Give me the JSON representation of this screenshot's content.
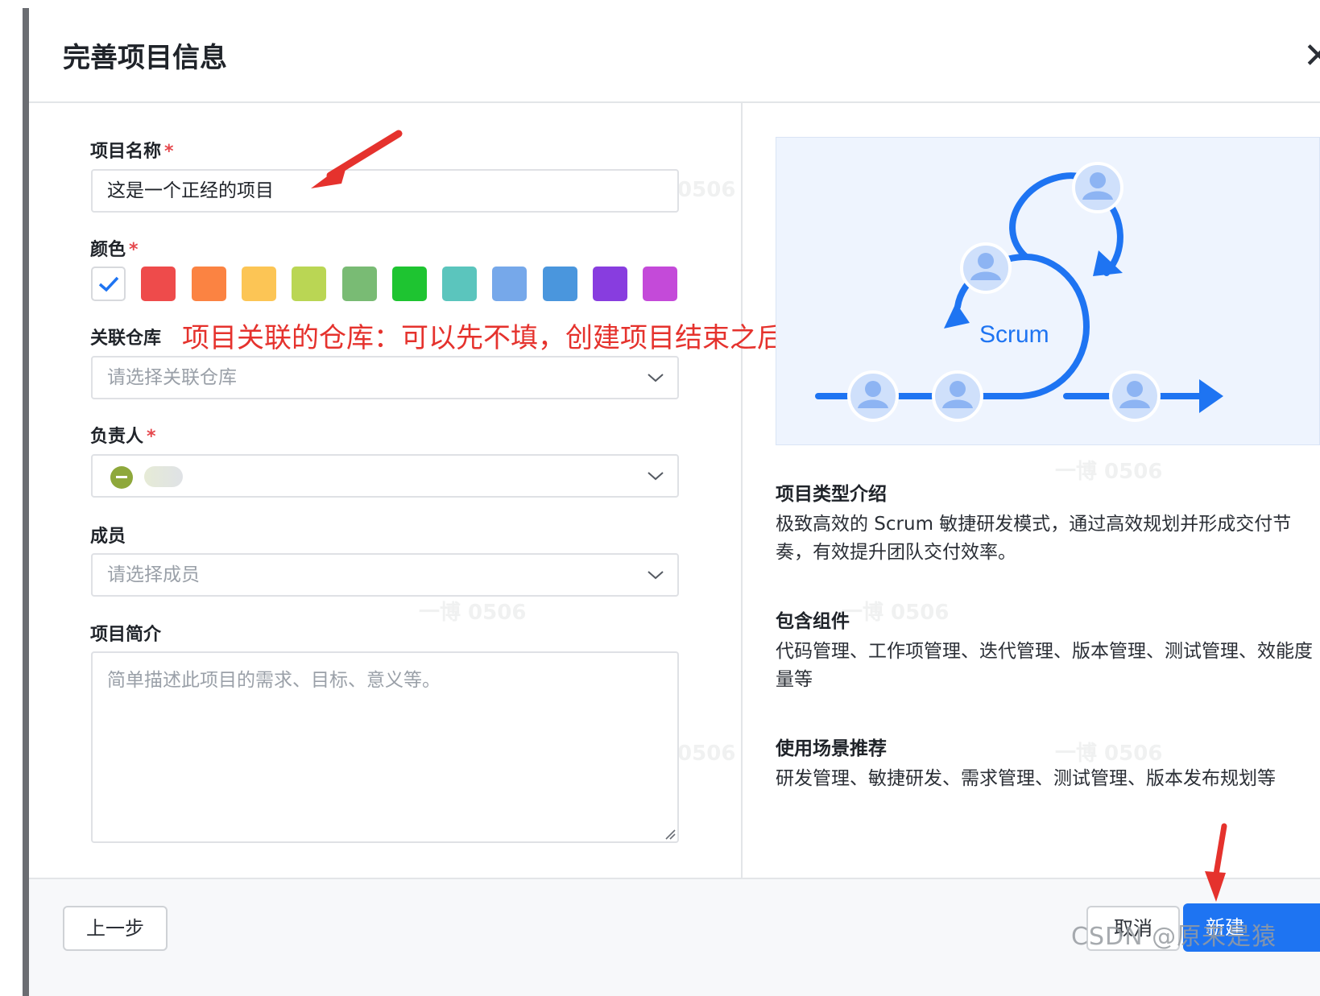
{
  "dialog": {
    "title": "完善项目信息"
  },
  "form": {
    "project_name": {
      "label": "项目名称",
      "required_mark": "*",
      "value": "这是一个正经的项目"
    },
    "color": {
      "label": "颜色",
      "required_mark": "*",
      "swatches": [
        "#ffffff",
        "#ee4b4b",
        "#fb8342",
        "#fcc555",
        "#bad654",
        "#79bb74",
        "#1ec431",
        "#5bc5bd",
        "#76a8ea",
        "#4a96dd",
        "#883ddf",
        "#c44ad9"
      ],
      "selected_index": 0
    },
    "repository": {
      "label": "关联仓库",
      "placeholder": "请选择关联仓库"
    },
    "owner": {
      "label": "负责人",
      "required_mark": "*"
    },
    "members": {
      "label": "成员",
      "placeholder": "请选择成员"
    },
    "description": {
      "label": "项目简介",
      "placeholder": "简单描述此项目的需求、目标、意义等。"
    }
  },
  "annotation": {
    "text": "项目关联的仓库：可以先不填，创建项目结束之后修改即可",
    "color": "#e5322d"
  },
  "illustration": {
    "label": "Scrum",
    "accent": "#1e74f2"
  },
  "info": {
    "intro_title": "项目类型介绍",
    "intro_body": "极致高效的 Scrum 敏捷研发模式，通过高效规划并形成交付节奏，有效提升团队交付效率。",
    "components_title": "包含组件",
    "components_body": "代码管理、工作项管理、迭代管理、版本管理、测试管理、效能度量等",
    "scenarios_title": "使用场景推荐",
    "scenarios_body": "研发管理、敏捷研发、需求管理、测试管理、版本发布规划等"
  },
  "footer": {
    "prev_label": "上一步",
    "cancel_label": "取消",
    "create_label": "新建"
  },
  "watermark": {
    "repeat_text": "一博 0506",
    "csdn_text": "CSDN @原来是猿"
  }
}
